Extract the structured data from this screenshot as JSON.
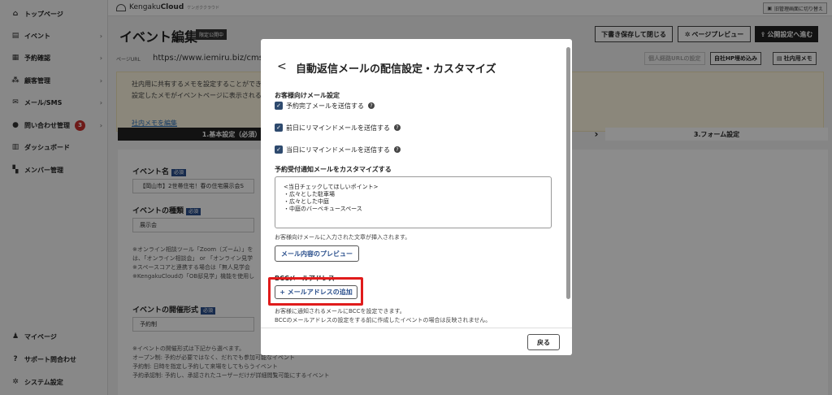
{
  "sidebar": {
    "items": [
      {
        "label": "トップページ",
        "icon": "home-icon",
        "glyph": "⌂",
        "chevron": false
      },
      {
        "label": "イベント",
        "icon": "file-icon",
        "glyph": "▤",
        "chevron": true
      },
      {
        "label": "予約確認",
        "icon": "calendar-icon",
        "glyph": "▦",
        "chevron": true
      },
      {
        "label": "顧客管理",
        "icon": "users-icon",
        "glyph": "⁂",
        "chevron": true
      },
      {
        "label": "メール/SMS",
        "icon": "mail-icon",
        "glyph": "✉",
        "chevron": true
      },
      {
        "label": "問い合わせ管理",
        "icon": "chat-icon",
        "glyph": "●",
        "chevron": true,
        "badge": "3"
      },
      {
        "label": "ダッシュボード",
        "icon": "chart-icon",
        "glyph": "▥",
        "chevron": false
      },
      {
        "label": "メンバー管理",
        "icon": "grid-icon",
        "glyph": "▚",
        "chevron": false
      }
    ],
    "bottom_items": [
      {
        "label": "マイページ",
        "icon": "person-icon",
        "glyph": "♟"
      },
      {
        "label": "サポート問合わせ",
        "icon": "question-icon",
        "glyph": "?"
      },
      {
        "label": "システム設定",
        "icon": "gear-icon",
        "glyph": "✲"
      }
    ]
  },
  "topbar": {
    "logo_text_prefix": "Kengaku",
    "logo_text_bold": "Cloud",
    "logo_tagline": "ケンガククラウド",
    "admin_switch": "旧管理画面に切り替え"
  },
  "header": {
    "title": "イベント編集",
    "status_badge": "限定公開中",
    "save_draft": "下書き保存して閉じる",
    "preview": "ページプレビュー",
    "publish": "公開設定へ進む"
  },
  "url_row": {
    "label": "ページURL",
    "url": "https://www.iemiru.biz/cms/yo",
    "copy_other": "個人経路URLの設定",
    "embed": "自社HP埋め込み",
    "memo": "社内用メモ"
  },
  "memo": {
    "line1": "社内用に共有するメモを設定することができ",
    "line2": "設定したメモがイベントページに表示される",
    "edit_link": "社内メモを編集"
  },
  "steps": {
    "step1": "1.基本設定（必須）",
    "step3": "3.フォーム設定"
  },
  "form": {
    "event_name_label": "イベント名",
    "required": "必須",
    "event_name_value": "【岡山市】2世帯住宅！春の住宅展示会S",
    "event_type_label": "イベントの種類",
    "event_type_value": "展示会",
    "type_notes": [
      "※オンライン相談ツール「Zoom（ズーム）」を",
      "は、「オンライン相談会」 or 「オンライン見学",
      "※スペースコアと連携する場合は「無人見学会",
      "※KengakuCloudの「OB邸見学」機能を使用し"
    ],
    "format_label": "イベントの開催形式",
    "format_value": "予約制",
    "format_notes": [
      "※イベントの開催形式は下記から選べます。",
      "オープン制: 予約が必要ではなく、だれでも参加可能なイベント",
      "予約制: 日時を指定し予約して来場をしてもらうイベント",
      "予約承認制: 予約し、承認されたユーザーだけが詳細閲覧可能にするイベント"
    ]
  },
  "modal": {
    "back": "<",
    "title": "自動返信メールの配信設定・カスタマイズ",
    "customer_section": "お客様向けメール設定",
    "checkboxes": [
      {
        "label": "予約完了メールを送信する",
        "checked": true
      },
      {
        "label": "前日にリマインドメールを送信する",
        "checked": true
      },
      {
        "label": "当日にリマインドメールを送信する",
        "checked": true
      }
    ],
    "customize_section": "予約受付通知メールをカスタマイズする",
    "textarea_value": "<当日チェックしてほしいポイント>\n・広々とした駐車場\n・広々とした中庭\n・中庭のバーベキュースペース",
    "textarea_note": "お客様向けメールに入力された文章が挿入されます。",
    "preview_button": "メール内容のプレビュー",
    "bcc_section": "BCCメールアドレス",
    "add_email_button": "+ メールアドレスの追加",
    "bcc_note1": "お客様に通知されるメールにBCCを設定できます。",
    "bcc_note2": "BCCのメールアドレスの設定をする前に作成したイベントの場合は反映されません。",
    "close_button": "戻る"
  },
  "colors": {
    "accent": "#2e4a6e",
    "highlight": "#e01b1b",
    "badge_red": "#c9302c"
  }
}
